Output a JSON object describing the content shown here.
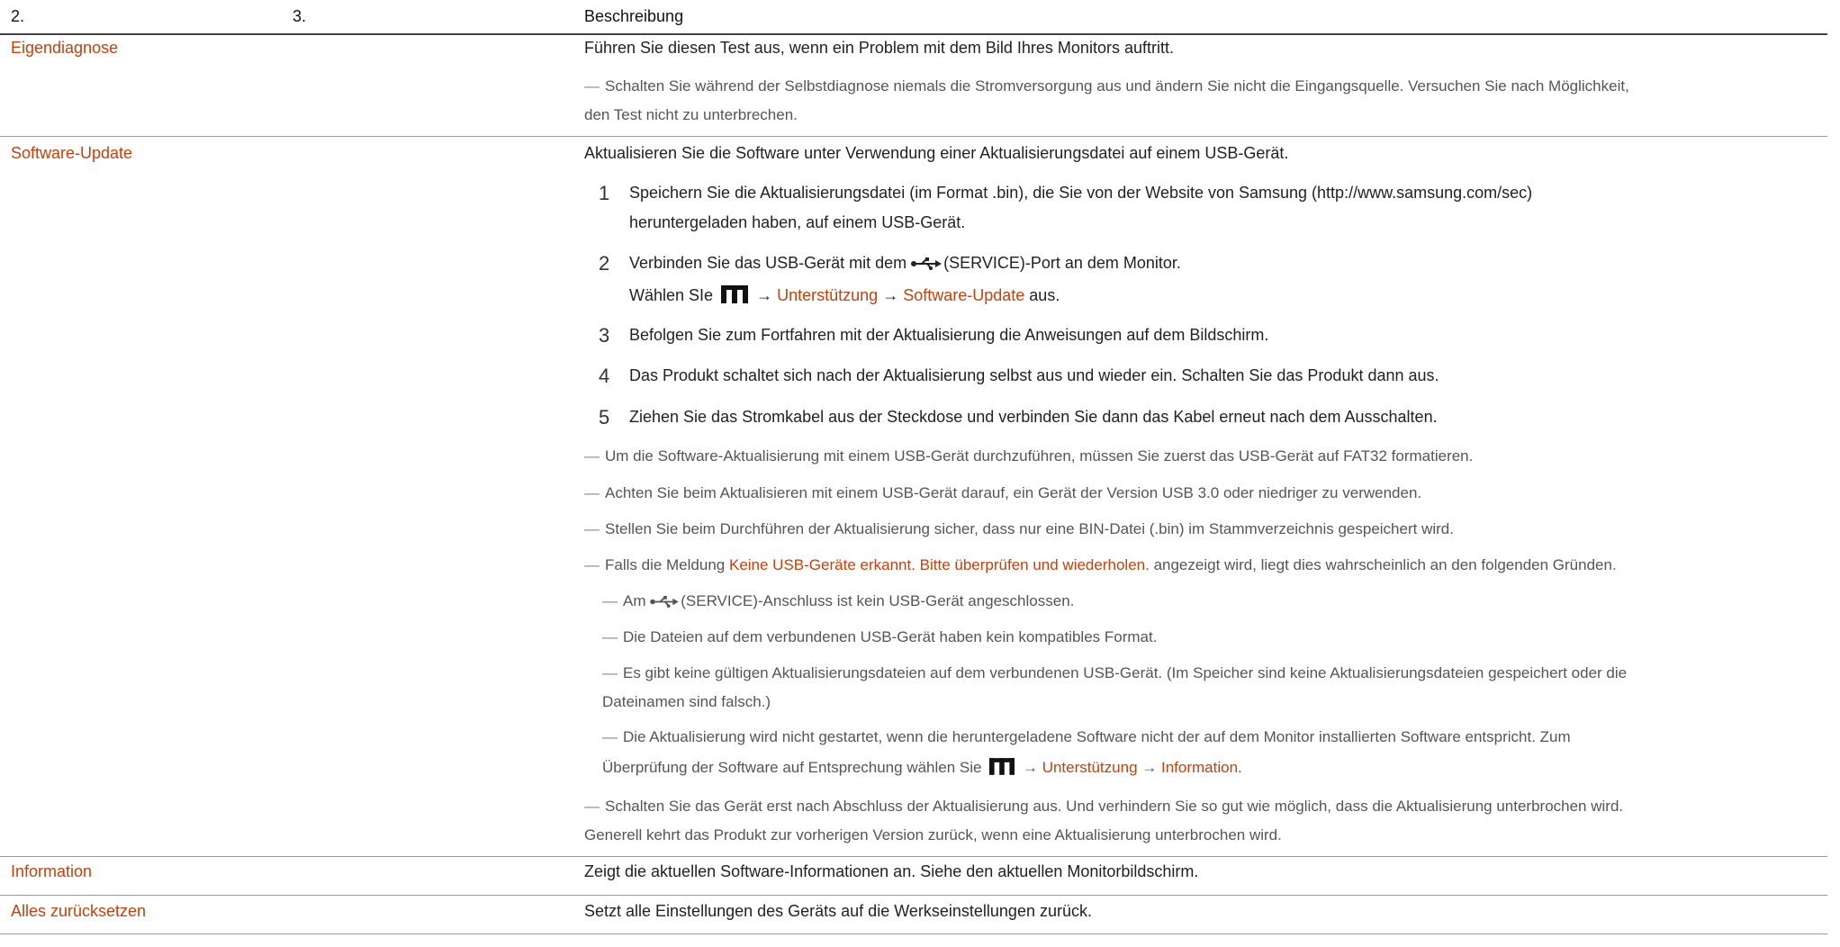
{
  "header": {
    "col1": "2.",
    "col2": "3.",
    "col3": "Beschreibung"
  },
  "rows": {
    "self_diag": {
      "menu": "Eigendiagnose",
      "desc": "Führen Sie diesen Test aus, wenn ein Problem mit dem Bild Ihres Monitors auftritt.",
      "note_l1": "Schalten Sie während der Selbstdiagnose niemals die Stromversorgung aus und ändern Sie nicht die Eingangsquelle. Versuchen Sie nach Möglichkeit,",
      "note_l2": "den Test nicht zu unterbrechen."
    },
    "sw_update": {
      "menu": "Software-Update",
      "desc": "Aktualisieren Sie die Software unter Verwendung einer Aktualisierungsdatei auf einem USB-Gerät.",
      "s1_num": "1",
      "s1_l1": "Speichern Sie die Aktualisierungsdatei (im Format .bin), die Sie von der Website von Samsung (http://www.samsung.com/sec)",
      "s1_l2": "heruntergeladen haben, auf einem USB-Gerät.",
      "s2_num": "2",
      "s2_a": "Verbinden Sie das USB-Gerät mit dem",
      "s2_service": "(SERVICE)",
      "s2_b": "-Port an dem Monitor.",
      "s2_c": "Wählen SIe",
      "arrow": "→",
      "s2_support": "Unterstützung",
      "s2_swupd": "Software-Update",
      "s2_end": "aus.",
      "s3_num": "3",
      "s3": "Befolgen Sie zum Fortfahren mit der Aktualisierung die Anweisungen auf dem Bildschirm.",
      "s4_num": "4",
      "s4": "Das Produkt schaltet sich nach der Aktualisierung selbst aus und wieder ein. Schalten Sie das Produkt dann aus.",
      "s5_num": "5",
      "s5": "Ziehen Sie das Stromkabel aus der Steckdose und verbinden Sie dann das Kabel erneut nach dem Ausschalten.",
      "n1": "Um die Software-Aktualisierung mit einem USB-Gerät durchzuführen, müssen Sie zuerst das USB-Gerät auf FAT32 formatieren.",
      "n2": "Achten Sie beim Aktualisieren mit einem USB-Gerät darauf, ein Gerät der Version USB 3.0 oder niedriger zu verwenden.",
      "n3": "Stellen Sie beim Durchführen der Aktualisierung sicher, dass nur eine BIN-Datei (.bin) im Stammverzeichnis gespeichert wird.",
      "n4_a": "Falls die Meldung",
      "n4_msg": "Keine USB-Geräte erkannt. Bitte überprüfen und wiederholen.",
      "n4_b": "angezeigt wird, liegt dies wahrscheinlich an den folgenden Gründen.",
      "sub1_a": "Am",
      "sub1_service": "(SERVICE)",
      "sub1_b": "-Anschluss ist kein USB-Gerät angeschlossen.",
      "sub2": "Die Dateien auf dem verbundenen USB-Gerät haben kein kompatibles Format.",
      "sub3_l1": "Es gibt keine gültigen Aktualisierungsdateien auf dem verbundenen USB-Gerät. (Im Speicher sind keine Aktualisierungsdateien gespeichert oder die",
      "sub3_l2": "Dateinamen sind falsch.)",
      "sub4_l1": "Die Aktualisierung wird nicht gestartet, wenn die heruntergeladene Software nicht der auf dem Monitor installierten Software entspricht. Zum",
      "sub4_l2a": "Überprüfung der Software auf Entsprechung wählen Sie",
      "sub4_support": "Unterstützung",
      "sub4_info": "Information",
      "sub4_end": ".",
      "n5_l1": "Schalten Sie das Gerät erst nach Abschluss der Aktualisierung aus. Und verhindern Sie so gut wie möglich, dass die Aktualisierung unterbrochen wird.",
      "n5_l2": "Generell kehrt das Produkt zur vorherigen Version zurück, wenn eine Aktualisierung unterbrochen wird."
    },
    "information": {
      "menu": "Information",
      "desc": "Zeigt die aktuellen Software-Informationen an. Siehe den aktuellen Monitorbildschirm."
    },
    "reset": {
      "menu": "Alles zurücksetzen",
      "desc": "Setzt alle Einstellungen des Geräts auf die Werkseinstellungen zurück."
    }
  },
  "note_mark": "―",
  "colors": {
    "accent": "#c8400c",
    "text": "#222222",
    "note": "#555555"
  },
  "icons": {
    "menu": "menu-icon",
    "usb": "usb-icon"
  }
}
